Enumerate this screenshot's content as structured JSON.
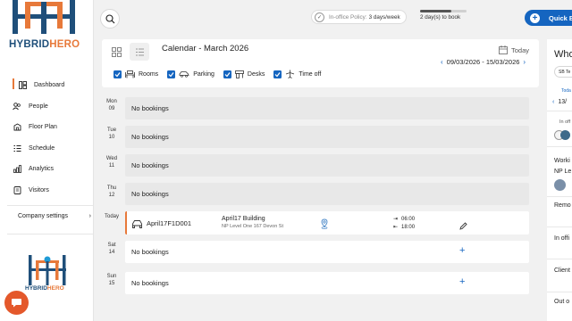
{
  "brand": {
    "name_part1": "HYBRID",
    "name_part2": "HERO",
    "primary": "#1f4f7a",
    "accent": "#e7793a"
  },
  "sidebar": {
    "items": [
      {
        "label": "Dashboard",
        "icon": "dashboard-icon",
        "active": true
      },
      {
        "label": "People",
        "icon": "people-icon"
      },
      {
        "label": "Floor Plan",
        "icon": "floor-plan-icon"
      },
      {
        "label": "Schedule",
        "icon": "schedule-icon"
      },
      {
        "label": "Analytics",
        "icon": "analytics-icon"
      },
      {
        "label": "Visitors",
        "icon": "visitors-icon"
      }
    ],
    "company_settings": "Company settings"
  },
  "topbar": {
    "policy_label": "In-office Policy:",
    "policy_value": "3 days/week",
    "progress_label": "2 day(s) to book",
    "progress_fraction": 0.67,
    "quick_label": "Quick B"
  },
  "calendar": {
    "title": "Calendar - March 2026",
    "today_label": "Today",
    "range": "09/03/2026 - 15/03/2026",
    "filters": [
      {
        "label": "Rooms",
        "icon": "rooms-icon",
        "checked": true
      },
      {
        "label": "Parking",
        "icon": "car-icon",
        "checked": true
      },
      {
        "label": "Desks",
        "icon": "desk-icon",
        "checked": true
      },
      {
        "label": "Time off",
        "icon": "plane-icon",
        "checked": true
      }
    ],
    "days": [
      {
        "dow": "Mon",
        "num": "09",
        "text": "No bookings"
      },
      {
        "dow": "Tue",
        "num": "10",
        "text": "No bookings"
      },
      {
        "dow": "Wed",
        "num": "11",
        "text": "No bookings"
      },
      {
        "dow": "Thu",
        "num": "12",
        "text": "No bookings"
      },
      {
        "dow": "Today",
        "num": ""
      },
      {
        "dow": "Sat",
        "num": "14",
        "text": "No bookings"
      },
      {
        "dow": "Sun",
        "num": "15",
        "text": "No bookings"
      }
    ],
    "booking": {
      "id": "April17F1D001",
      "building": "April17 Building",
      "address": "NP Level One 167 Devon St",
      "start": "06:00",
      "end": "18:00"
    }
  },
  "right_panel": {
    "title": "Who",
    "team": "SB Te",
    "today": "Toda",
    "date": "13/",
    "in_office": "In off",
    "working": "Worki",
    "np_level": "NP Le",
    "remote": "Remo",
    "in_office2": "In offi",
    "client": "Client",
    "out_of": "Out o"
  }
}
